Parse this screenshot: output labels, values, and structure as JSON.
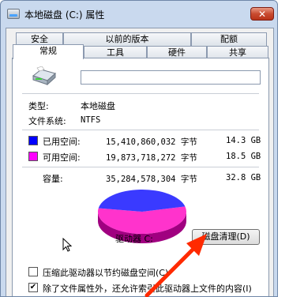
{
  "window": {
    "title": "本地磁盘 (C:) 属性",
    "close_glyph": "✕"
  },
  "tabs_row1": [
    "安全",
    "以前的版本",
    "配额"
  ],
  "tabs_row2": [
    "常规",
    "工具",
    "硬件",
    "共享"
  ],
  "active_tab": "常规",
  "general": {
    "drive_icon": "hard-drive-icon",
    "name_value": "",
    "type_label": "类型:",
    "type_value": "本地磁盘",
    "fs_label": "文件系统:",
    "fs_value": "NTFS",
    "used": {
      "label": "已用空间:",
      "bytes": "15,410,860,032 字节",
      "size": "14.3 GB",
      "color": "#0000ff"
    },
    "free": {
      "label": "可用空间:",
      "bytes": "19,873,718,272 字节",
      "size": "18.5 GB",
      "color": "#ff00ff"
    },
    "capacity": {
      "label": "容量:",
      "bytes": "35,284,578,304 字节",
      "size": "32.8 GB"
    },
    "pie": {
      "used_fraction": 0.4368,
      "used_color": "#3a3aff",
      "free_color": "#ff33cc",
      "shadow_used": "#0000a0",
      "shadow_free": "#a00080"
    },
    "drive_label": "驱动器 C:",
    "cleanup_button": "磁盘清理(D)",
    "compress_checkbox": {
      "label": "压缩此驱动器以节约磁盘空间(C)",
      "checked": false
    },
    "index_checkbox": {
      "label": "除了文件属性外，还允许索引此驱动器上文件的内容(I)",
      "checked": true
    }
  }
}
